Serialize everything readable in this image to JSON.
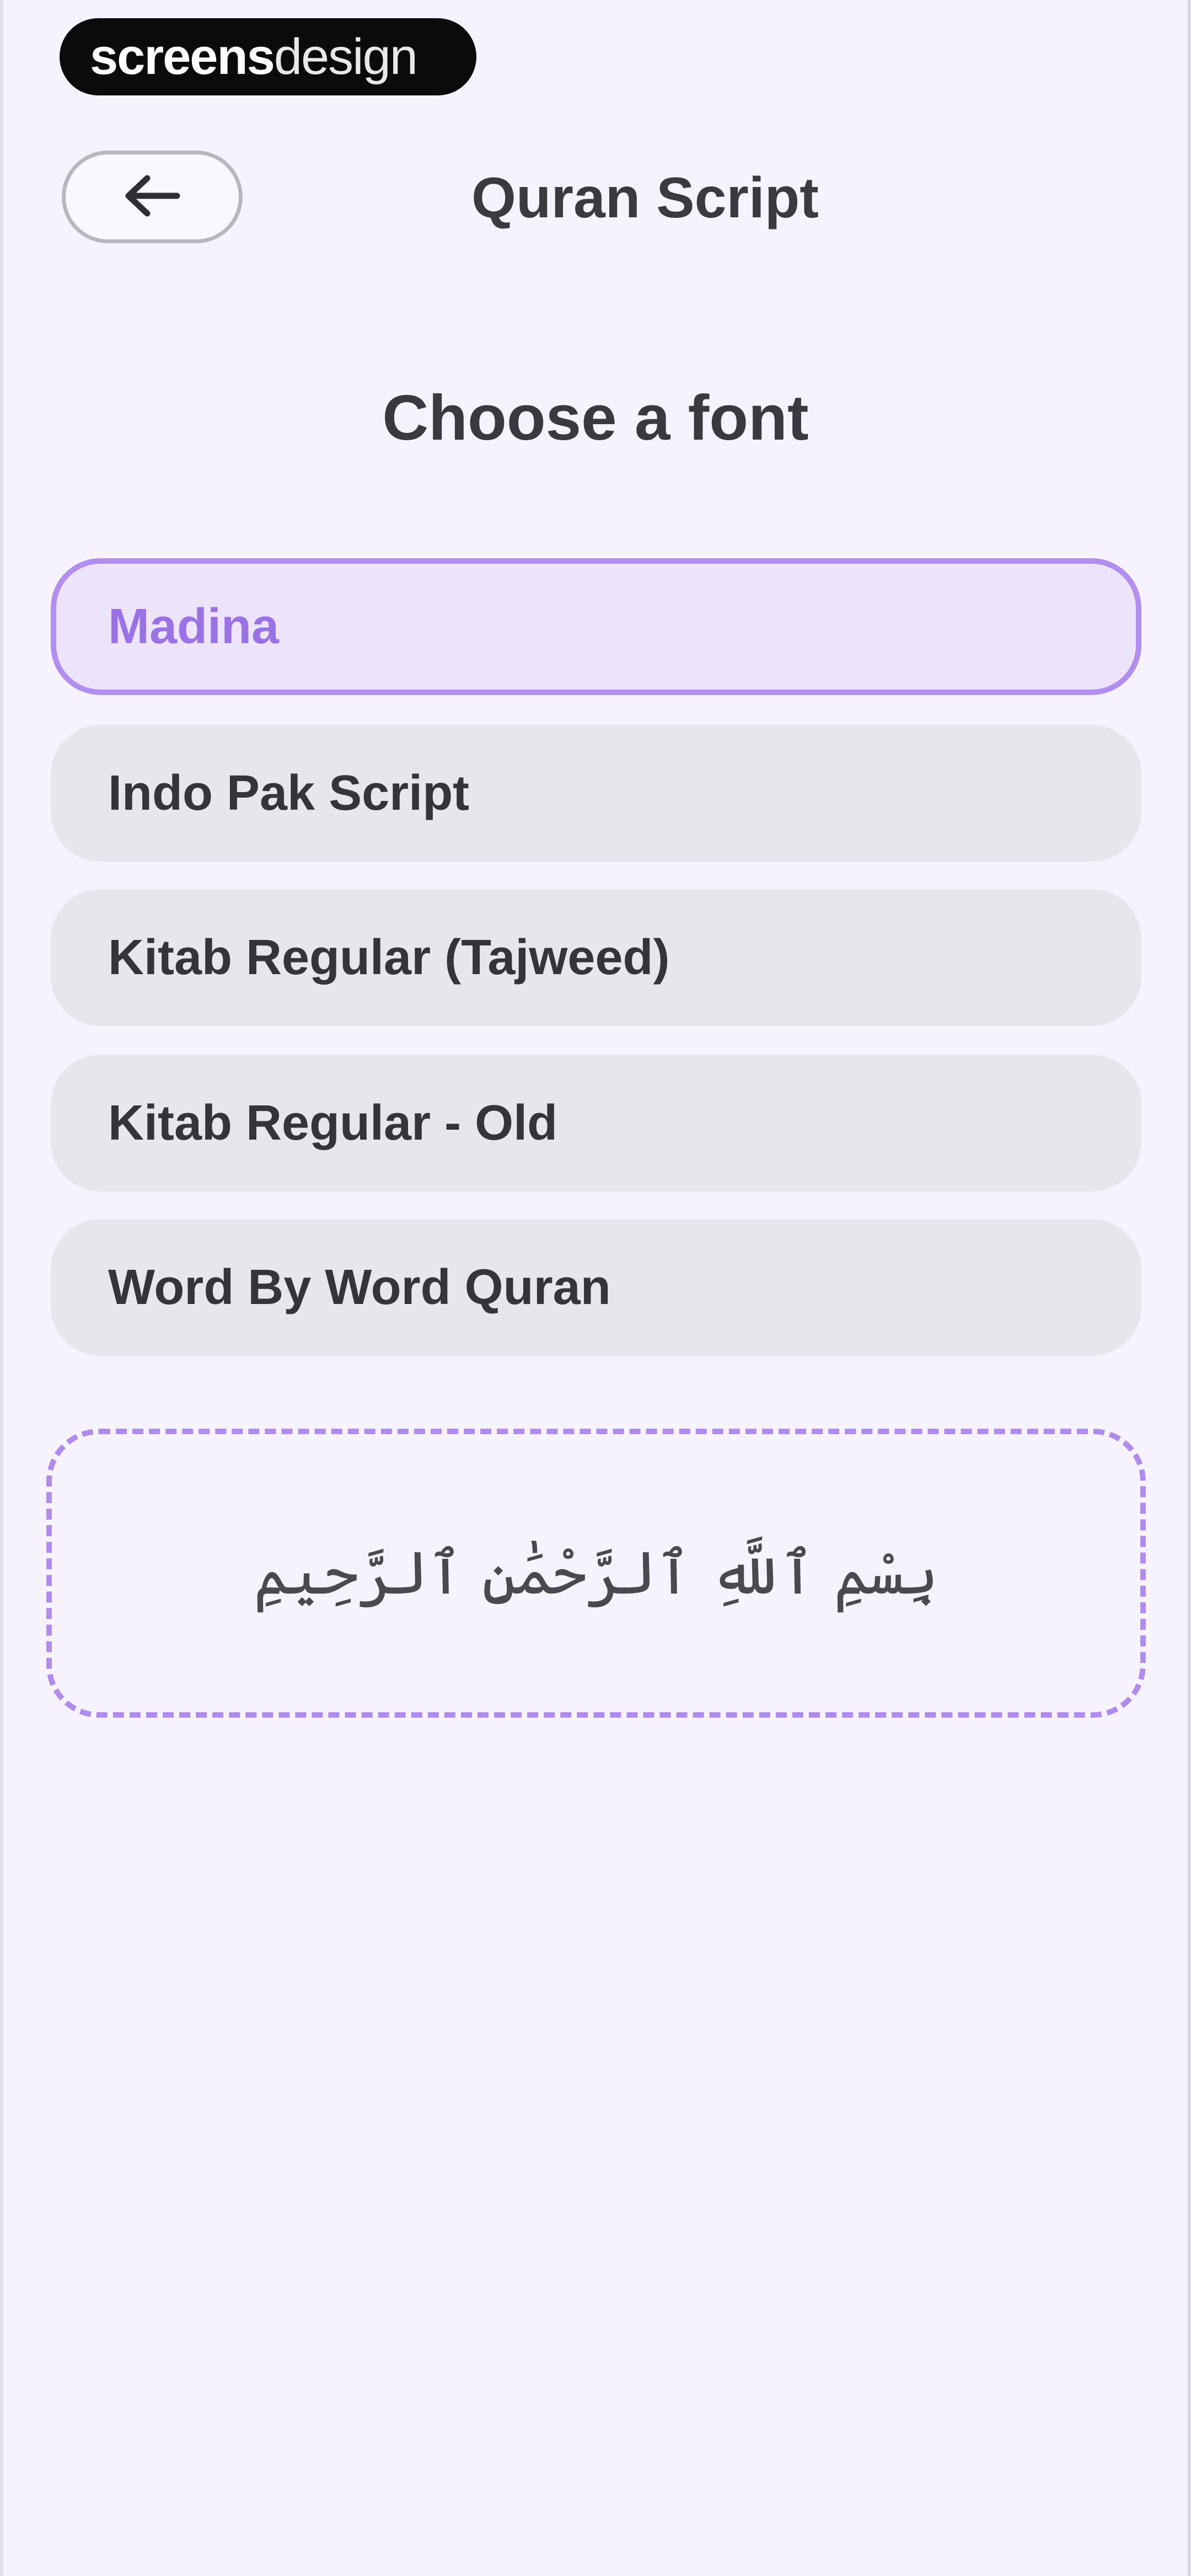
{
  "watermark": {
    "bold": "screens",
    "thin": "design"
  },
  "header": {
    "back_icon": "arrow-left-icon",
    "title": "Quran Script"
  },
  "main": {
    "heading": "Choose a font",
    "selected_index": 0,
    "options": [
      {
        "label": "Madina"
      },
      {
        "label": "Indo Pak Script"
      },
      {
        "label": "Kitab Regular (Tajweed)"
      },
      {
        "label": "Kitab Regular - Old"
      },
      {
        "label": "Word By Word Quran"
      }
    ],
    "preview_text": "بِسْمِ ٱللَّهِ ٱلرَّحْمَٰنِ ٱلرَّحِيمِ"
  },
  "colors": {
    "background": "#f7f3fe",
    "accent": "#b18ef0",
    "accent_text": "#9a72e6",
    "option_bg": "#e8e5ed",
    "selected_bg": "#ede4fb"
  }
}
